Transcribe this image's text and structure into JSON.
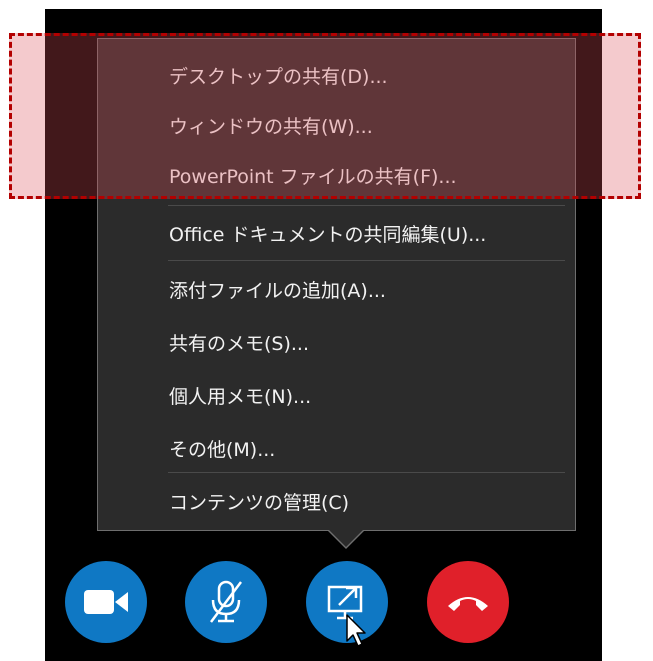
{
  "menu": {
    "items": [
      {
        "label": "デスクトップの共有(D)..."
      },
      {
        "label": "ウィンドウの共有(W)..."
      },
      {
        "label": "PowerPoint ファイルの共有(F)..."
      },
      {
        "label": "Office ドキュメントの共同編集(U)..."
      },
      {
        "label": "添付ファイルの追加(A)..."
      },
      {
        "label": "共有のメモ(S)..."
      },
      {
        "label": "個人用メモ(N)..."
      },
      {
        "label": "その他(M)..."
      },
      {
        "label": "コンテンツの管理(C)"
      }
    ]
  },
  "controls": [
    {
      "icon": "video-camera-icon",
      "color": "#0f78c4"
    },
    {
      "icon": "microphone-muted-icon",
      "color": "#0f78c4"
    },
    {
      "icon": "share-screen-icon",
      "color": "#0f78c4"
    },
    {
      "icon": "hang-up-phone-icon",
      "color": "#e0202a"
    }
  ],
  "highlight": {
    "color": "#b30000"
  }
}
